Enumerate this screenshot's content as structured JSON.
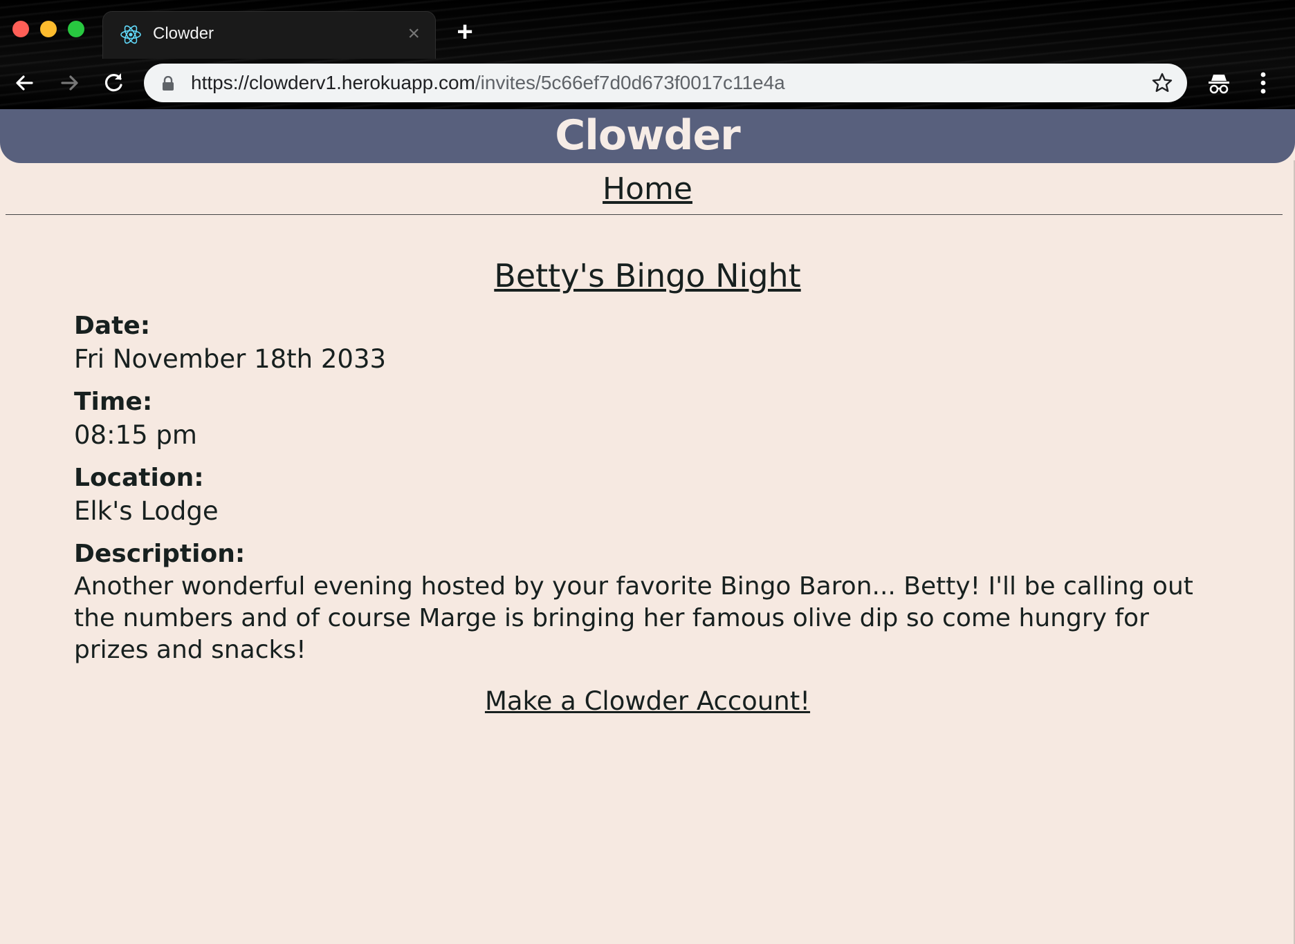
{
  "browser": {
    "tab_title": "Clowder",
    "new_tab_label": "+",
    "close_label": "×",
    "url_host": "https://clowderv1.herokuapp.com",
    "url_path": "/invites/5c66ef7d0d673f0017c11e4a"
  },
  "header": {
    "title": "Clowder"
  },
  "nav": {
    "home_label": "Home"
  },
  "event": {
    "title": "Betty's Bingo Night",
    "date_label": "Date:",
    "date_value": "Fri November 18th 2033",
    "time_label": "Time:",
    "time_value": "08:15 pm",
    "location_label": "Location:",
    "location_value": "Elk's Lodge",
    "description_label": "Description:",
    "description_value": "Another wonderful evening hosted by your favorite Bingo Baron... Betty! I'll be calling out the numbers and of course Marge is bringing her famous olive dip so come hungry for prizes and snacks!"
  },
  "cta": {
    "account_label": "Make a Clowder Account!"
  },
  "icons": [
    "react-icon",
    "close-icon",
    "plus-icon",
    "back-arrow-icon",
    "forward-arrow-icon",
    "reload-icon",
    "lock-icon",
    "star-icon",
    "incognito-icon",
    "kebab-menu-icon"
  ],
  "colors": {
    "header_bg": "#58607d",
    "page_bg": "#f6e9e1",
    "text": "#17201f"
  }
}
